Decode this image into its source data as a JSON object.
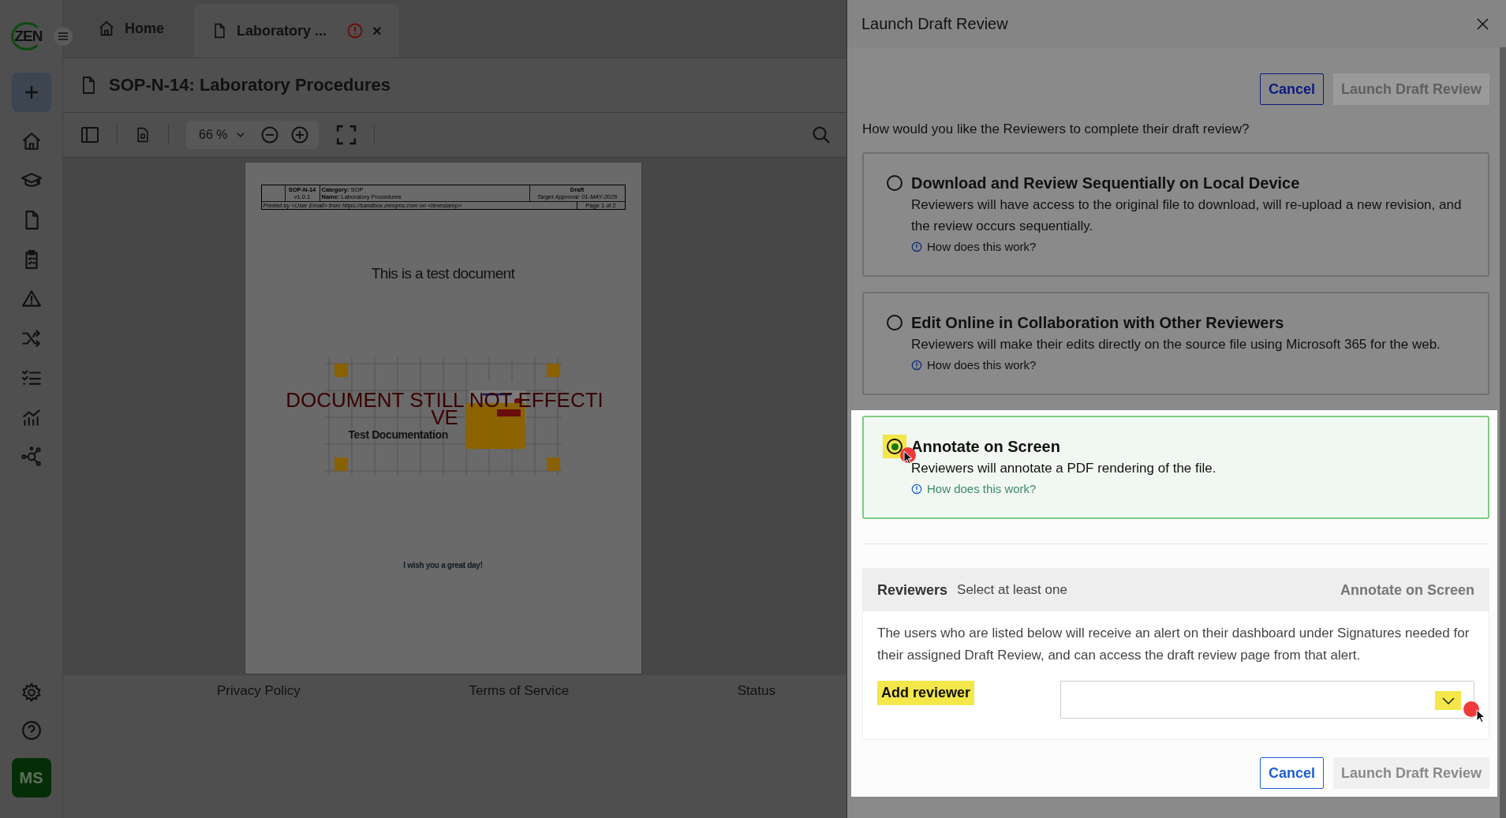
{
  "app": {
    "logo": "ZEN",
    "avatar": "MS"
  },
  "tabs": [
    {
      "label": "Home",
      "kind": "home",
      "selected": false,
      "alert": false,
      "closable": false
    },
    {
      "label": "Laboratory ...",
      "kind": "document",
      "selected": true,
      "alert": true,
      "closable": true
    }
  ],
  "close_glyph": "×",
  "document": {
    "title": "SOP-N-14: Laboratory Procedures",
    "zoom": "66 %",
    "header": {
      "code": "SOP-N-14",
      "version": "v1.0.1",
      "category": "**Category:** SOP",
      "name": "**Name:** Laboratory Procedures",
      "status": "Draft",
      "target": "*Target Approval: 01-MAY-2026*",
      "printed": "*Printed by <User Email> from https://sandbox.zenqms.com on <timestamp>*",
      "page": "Page 1 of 2"
    },
    "heading": "This is a test document",
    "watermark_lines": [
      "DOCUMENT STILL NOT EFFECTI",
      "VE"
    ],
    "caption": "Test Documentation",
    "closing": "I wish you a great day!"
  },
  "footer": [
    "Privacy Policy",
    "Terms of Service",
    "Status"
  ],
  "dialog": {
    "title": "Launch Draft Review",
    "cancel": "Cancel",
    "launch": {
      "label": "Launch Draft Review",
      "disabled": true
    },
    "question": "How would you like the Reviewers to complete their draft review?",
    "options": [
      {
        "title": "Download and Review Sequentially on Local Device",
        "description": "Reviewers will have access to the original file to download, will re-upload a new revision, and the review occurs sequentially.",
        "link": "How does this work?",
        "selected": false
      },
      {
        "title": "Edit Online in Collaboration with Other Reviewers",
        "description": "Reviewers will make their edits directly on the source file using Microsoft 365 for the web.",
        "link": "How does this work?",
        "selected": false
      },
      {
        "title": "Annotate on Screen",
        "description": "Reviewers will annotate a PDF rendering of the file.",
        "link": "How does this work?",
        "selected": true
      }
    ],
    "reviewers": {
      "label": "Reviewers",
      "hint": "Select at least one",
      "mode": "Annotate on Screen",
      "info": "The users who are listed below will receive an alert on their dashboard under Signatures needed for their assigned Draft Review, and can access the draft review page from that alert.",
      "add_label": "Add reviewer"
    },
    "bottom_cancel": "Cancel",
    "bottom_launch": {
      "label": "Launch Draft Review",
      "disabled": true
    }
  }
}
